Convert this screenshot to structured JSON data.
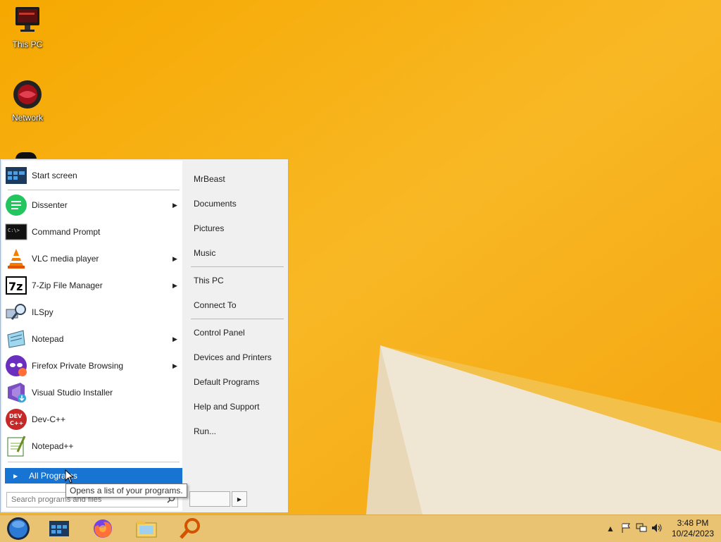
{
  "desktop": {
    "icons": [
      {
        "label": "This PC",
        "icon": "computer-monitor-icon"
      },
      {
        "label": "Network",
        "icon": "network-globe-icon"
      }
    ]
  },
  "start_menu": {
    "pinned": [
      {
        "label": "Start screen",
        "icon": "start-screen-icon",
        "submenu": false
      }
    ],
    "recent": [
      {
        "label": "Dissenter",
        "icon": "dissenter-icon",
        "submenu": true
      },
      {
        "label": "Command Prompt",
        "icon": "command-prompt-icon",
        "submenu": false
      },
      {
        "label": "VLC media player",
        "icon": "vlc-cone-icon",
        "submenu": true
      },
      {
        "label": "7-Zip File Manager",
        "icon": "7zip-icon",
        "submenu": true
      },
      {
        "label": "ILSpy",
        "icon": "ilspy-icon",
        "submenu": false
      },
      {
        "label": "Notepad",
        "icon": "notepad-icon",
        "submenu": true
      },
      {
        "label": "Firefox Private Browsing",
        "icon": "firefox-private-icon",
        "submenu": true
      },
      {
        "label": "Visual Studio Installer",
        "icon": "visual-studio-installer-icon",
        "submenu": false
      },
      {
        "label": "Dev-C++",
        "icon": "devcpp-icon",
        "submenu": false
      },
      {
        "label": "Notepad++",
        "icon": "notepadpp-icon",
        "submenu": false
      }
    ],
    "all_programs_label": "All Programs",
    "search_placeholder": "Search programs and files",
    "right_items_group1": [
      "MrBeast",
      "Documents",
      "Pictures",
      "Music"
    ],
    "right_items_group2": [
      "This PC",
      "Connect To"
    ],
    "right_items_group3": [
      "Control Panel",
      "Devices and Printers",
      "Default Programs",
      "Help and Support",
      "Run..."
    ],
    "tooltip": "Opens a list of your programs."
  },
  "taskbar": {
    "buttons": [
      "start-orb-icon",
      "start-screen-icon",
      "firefox-icon",
      "file-explorer-icon",
      "search-magnifier-icon"
    ],
    "tray": [
      "show-hidden-icons-icon",
      "action-center-flag-icon",
      "network-icon",
      "volume-icon"
    ],
    "time": "3:48 PM",
    "date": "10/24/2023"
  },
  "colors": {
    "wallpaper": "#f5b21a",
    "highlight": "#1874d2",
    "taskbar": "#e9c372"
  }
}
